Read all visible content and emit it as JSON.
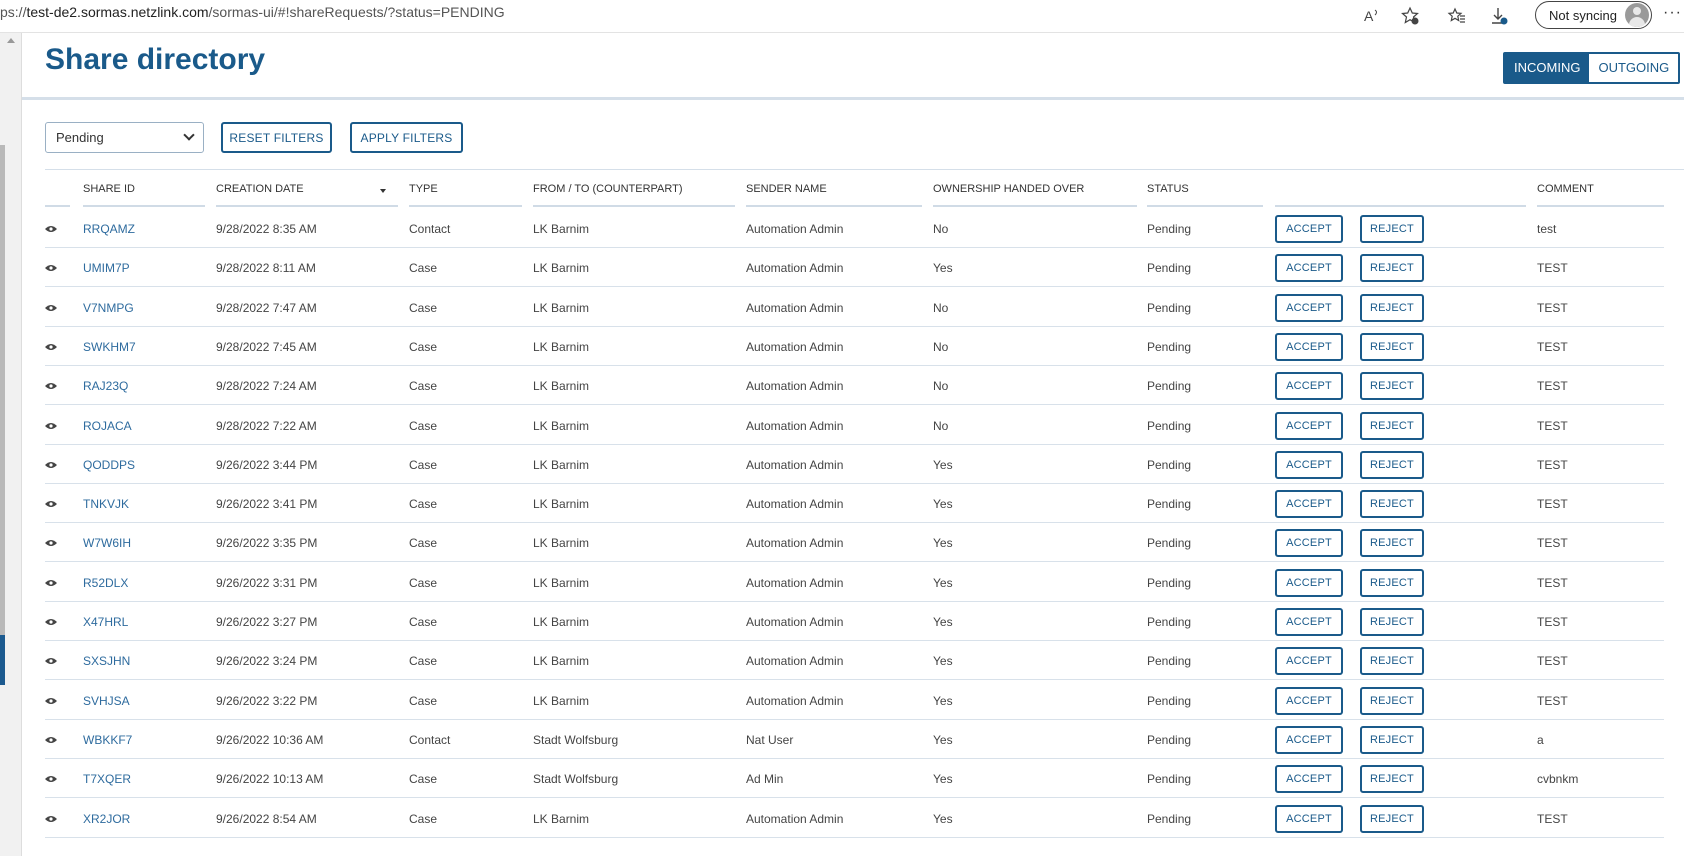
{
  "browser": {
    "url_prefix": "ps://",
    "url_host": "test-de2.sormas.netzlink.com",
    "url_path": "/sormas-ui/#!shareRequests/?status=PENDING",
    "sync_label": "Not syncing",
    "more_label": "···",
    "icons": [
      "read-aloud-icon",
      "add-favorite-icon",
      "favorites-icon",
      "downloads-icon",
      "profile-icon"
    ]
  },
  "page": {
    "title": "Share directory",
    "toggle": {
      "incoming": "INCOMING",
      "outgoing": "OUTGOING",
      "active": "incoming"
    }
  },
  "filters": {
    "status_value": "Pending",
    "reset_label": "RESET FILTERS",
    "apply_label": "APPLY FILTERS"
  },
  "table": {
    "headers": {
      "share_id": "SHARE ID",
      "creation_date": "CREATION DATE",
      "type": "TYPE",
      "from_to": "FROM / TO (COUNTERPART)",
      "sender_name": "SENDER NAME",
      "ownership": "OWNERSHIP HANDED OVER",
      "status": "STATUS",
      "comment": "COMMENT"
    },
    "accept_label": "ACCEPT",
    "reject_label": "REJECT",
    "rows": [
      {
        "id": "RRQAMZ",
        "date": "9/28/2022 8:35 AM",
        "type": "Contact",
        "from": "LK Barnim",
        "sender": "Automation Admin",
        "ownership": "No",
        "status": "Pending",
        "comment": "test"
      },
      {
        "id": "UMIM7P",
        "date": "9/28/2022 8:11 AM",
        "type": "Case",
        "from": "LK Barnim",
        "sender": "Automation Admin",
        "ownership": "Yes",
        "status": "Pending",
        "comment": "TEST"
      },
      {
        "id": "V7NMPG",
        "date": "9/28/2022 7:47 AM",
        "type": "Case",
        "from": "LK Barnim",
        "sender": "Automation Admin",
        "ownership": "No",
        "status": "Pending",
        "comment": "TEST"
      },
      {
        "id": "SWKHM7",
        "date": "9/28/2022 7:45 AM",
        "type": "Case",
        "from": "LK Barnim",
        "sender": "Automation Admin",
        "ownership": "No",
        "status": "Pending",
        "comment": "TEST"
      },
      {
        "id": "RAJ23Q",
        "date": "9/28/2022 7:24 AM",
        "type": "Case",
        "from": "LK Barnim",
        "sender": "Automation Admin",
        "ownership": "No",
        "status": "Pending",
        "comment": "TEST"
      },
      {
        "id": "ROJACA",
        "date": "9/28/2022 7:22 AM",
        "type": "Case",
        "from": "LK Barnim",
        "sender": "Automation Admin",
        "ownership": "No",
        "status": "Pending",
        "comment": "TEST"
      },
      {
        "id": "QODDPS",
        "date": "9/26/2022 3:44 PM",
        "type": "Case",
        "from": "LK Barnim",
        "sender": "Automation Admin",
        "ownership": "Yes",
        "status": "Pending",
        "comment": "TEST"
      },
      {
        "id": "TNKVJK",
        "date": "9/26/2022 3:41 PM",
        "type": "Case",
        "from": "LK Barnim",
        "sender": "Automation Admin",
        "ownership": "Yes",
        "status": "Pending",
        "comment": "TEST"
      },
      {
        "id": "W7W6IH",
        "date": "9/26/2022 3:35 PM",
        "type": "Case",
        "from": "LK Barnim",
        "sender": "Automation Admin",
        "ownership": "Yes",
        "status": "Pending",
        "comment": "TEST"
      },
      {
        "id": "R52DLX",
        "date": "9/26/2022 3:31 PM",
        "type": "Case",
        "from": "LK Barnim",
        "sender": "Automation Admin",
        "ownership": "Yes",
        "status": "Pending",
        "comment": "TEST"
      },
      {
        "id": "X47HRL",
        "date": "9/26/2022 3:27 PM",
        "type": "Case",
        "from": "LK Barnim",
        "sender": "Automation Admin",
        "ownership": "Yes",
        "status": "Pending",
        "comment": "TEST"
      },
      {
        "id": "SXSJHN",
        "date": "9/26/2022 3:24 PM",
        "type": "Case",
        "from": "LK Barnim",
        "sender": "Automation Admin",
        "ownership": "Yes",
        "status": "Pending",
        "comment": "TEST"
      },
      {
        "id": "SVHJSA",
        "date": "9/26/2022 3:22 PM",
        "type": "Case",
        "from": "LK Barnim",
        "sender": "Automation Admin",
        "ownership": "Yes",
        "status": "Pending",
        "comment": "TEST"
      },
      {
        "id": "WBKKF7",
        "date": "9/26/2022 10:36 AM",
        "type": "Contact",
        "from": "Stadt Wolfsburg",
        "sender": "Nat User",
        "ownership": "Yes",
        "status": "Pending",
        "comment": "a"
      },
      {
        "id": "T7XQER",
        "date": "9/26/2022 10:13 AM",
        "type": "Case",
        "from": "Stadt Wolfsburg",
        "sender": "Ad Min",
        "ownership": "Yes",
        "status": "Pending",
        "comment": "cvbnkm"
      },
      {
        "id": "XR2JOR",
        "date": "9/26/2022 8:54 AM",
        "type": "Case",
        "from": "LK Barnim",
        "sender": "Automation Admin",
        "ownership": "Yes",
        "status": "Pending",
        "comment": "TEST"
      }
    ]
  },
  "colors": {
    "brand": "#1a5a8a",
    "link": "#2e6b9e"
  }
}
